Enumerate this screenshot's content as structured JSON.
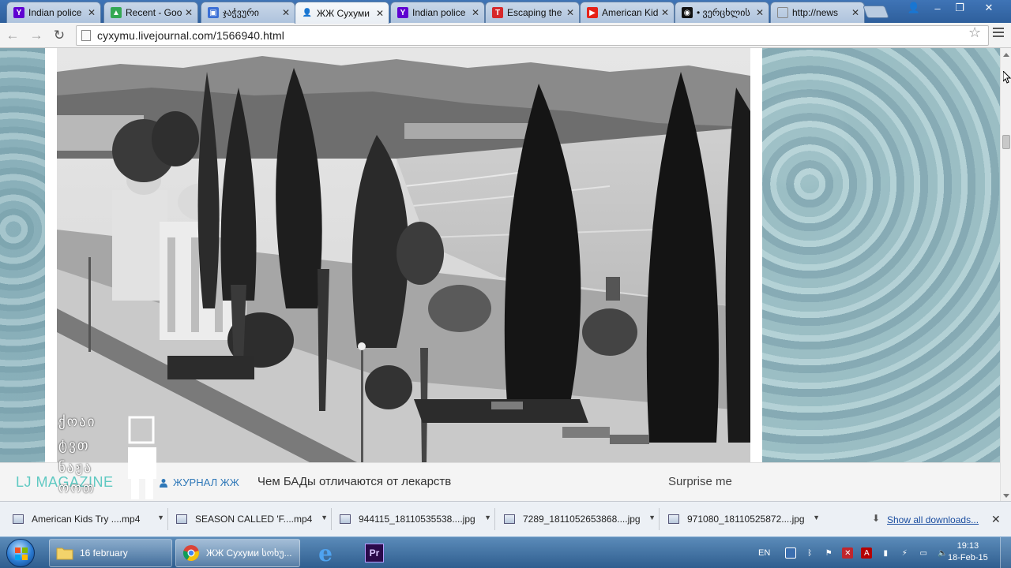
{
  "tabs": [
    {
      "title": "Indian police",
      "icon": "yahoo-icon",
      "color": "#5f01d1"
    },
    {
      "title": "Recent - Google",
      "icon": "google-drive-icon",
      "color": "#34a853"
    },
    {
      "title": "ჯაჭვური",
      "icon": "site-icon",
      "color": "#3b6fd6"
    },
    {
      "title": "ЖЖ Сухуми",
      "icon": "lj-user-icon",
      "color": "#333333"
    },
    {
      "title": "Indian police",
      "icon": "yahoo-icon",
      "color": "#5f01d1"
    },
    {
      "title": "Escaping the",
      "icon": "t-icon",
      "color": "#d6282b"
    },
    {
      "title": "American Kids",
      "icon": "youtube-icon",
      "color": "#e62117"
    },
    {
      "title": "• ვერცხლის",
      "icon": "video-icon",
      "color": "#111111"
    },
    {
      "title": "http://news",
      "icon": "page-icon",
      "color": "#8a8a8a"
    }
  ],
  "address_bar": {
    "url": "cyxymu.livejournal.com/1566940.html"
  },
  "lj_bar": {
    "logo": "LJ MAGAZINE",
    "section": "ЖУРНАЛ ЖЖ",
    "headline": "Чем БАДы отличаются от лекарств",
    "surprise": "Surprise me"
  },
  "watermark": {
    "line1": "ქოაი",
    "line2": "ტვთ",
    "line3": "ნაჟა",
    "line4": "ოოთ"
  },
  "downloads": {
    "items": [
      {
        "name": "American Kids Try ....mp4",
        "type": "video-file-icon"
      },
      {
        "name": "SEASON CALLED 'F....mp4",
        "type": "video-file-icon"
      },
      {
        "name": "944115_18110535538....jpg",
        "type": "image-file-icon"
      },
      {
        "name": "7289_1811052653868....jpg",
        "type": "image-file-icon"
      },
      {
        "name": "971080_18110525872....jpg",
        "type": "image-file-icon"
      }
    ],
    "show_all": "Show all downloads..."
  },
  "taskbar": {
    "folder_label": "16 february",
    "chrome_label": "ЖЖ Сухуми სოხუ...",
    "tray_lang": "EN",
    "time": "19:13",
    "date": "18-Feb-15"
  }
}
